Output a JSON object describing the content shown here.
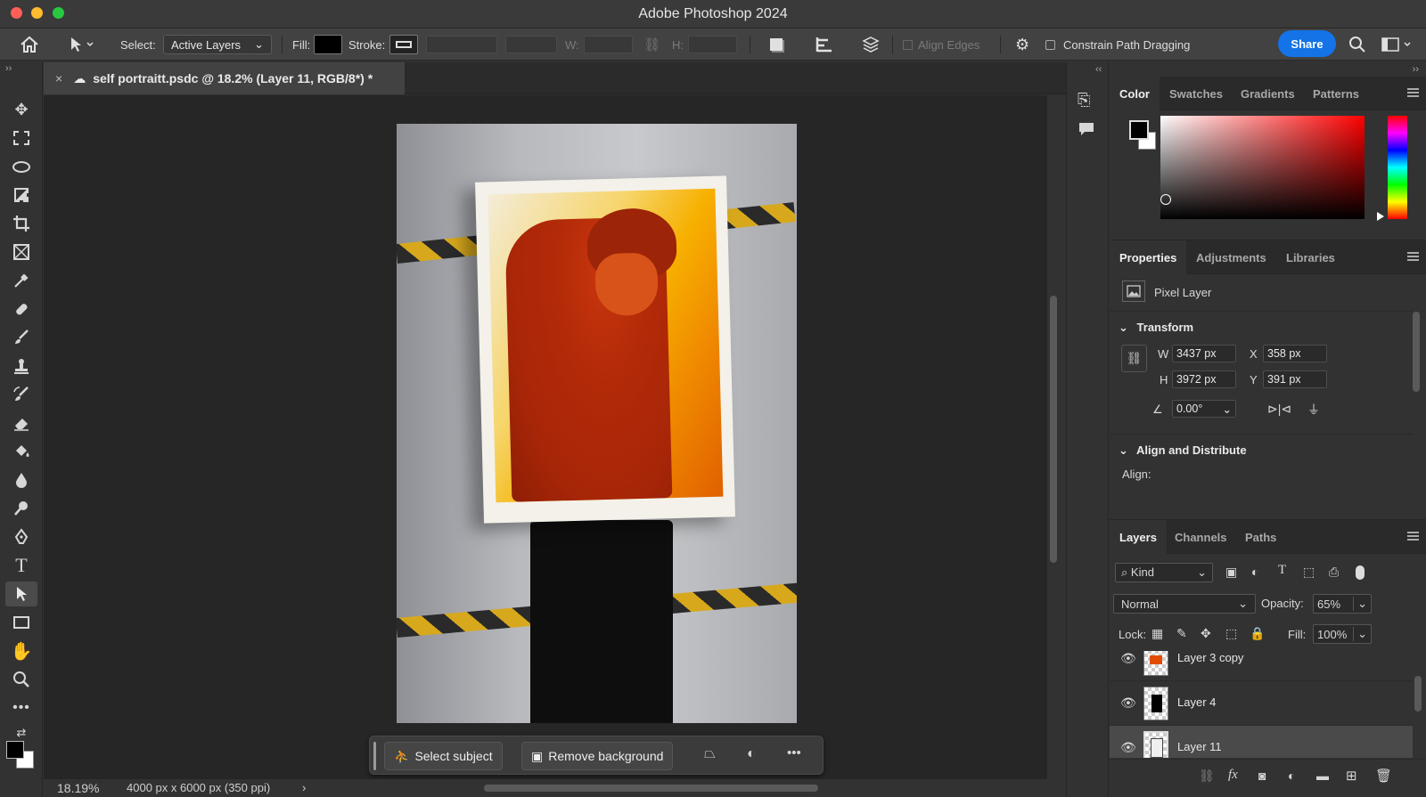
{
  "window": {
    "title": "Adobe Photoshop 2024"
  },
  "options_bar": {
    "select_label": "Select:",
    "select_value": "Active Layers",
    "fill_label": "Fill:",
    "stroke_label": "Stroke:",
    "w_label": "W:",
    "h_label": "H:",
    "align_edges_label": "Align Edges",
    "constrain_label": "Constrain Path Dragging",
    "share_label": "Share"
  },
  "document": {
    "tab_title": "self portraitt.psdc @ 18.2% (Layer 11, RGB/8*) *",
    "zoom": "18.19%",
    "doc_info": "4000 px x 6000 px (350 ppi)"
  },
  "context_bar": {
    "select_subject": "Select subject",
    "remove_background": "Remove background"
  },
  "color_panel": {
    "tabs": [
      "Color",
      "Swatches",
      "Gradients",
      "Patterns"
    ],
    "foreground": "#000000",
    "background": "#ffffff"
  },
  "properties_panel": {
    "tabs": [
      "Properties",
      "Adjustments",
      "Libraries"
    ],
    "layer_type": "Pixel Layer",
    "transform_title": "Transform",
    "w_label": "W",
    "h_label": "H",
    "x_label": "X",
    "y_label": "Y",
    "w_value": "3437 px",
    "h_value": "3972 px",
    "x_value": "358 px",
    "y_value": "391 px",
    "angle_value": "0.00°",
    "align_title": "Align and Distribute",
    "align_label": "Align:"
  },
  "layers_panel": {
    "tabs": [
      "Layers",
      "Channels",
      "Paths"
    ],
    "kind_label": "Kind",
    "blend_mode": "Normal",
    "opacity_label": "Opacity:",
    "opacity_value": "65%",
    "lock_label": "Lock:",
    "fill_label": "Fill:",
    "fill_value": "100%",
    "layers": [
      {
        "name": "Layer 3 copy",
        "selected": false
      },
      {
        "name": "Layer 4",
        "selected": false
      },
      {
        "name": "Layer 11",
        "selected": true
      }
    ]
  },
  "colors": {
    "accent": "#1473e6",
    "panel": "#323232",
    "canvas": "#262626"
  }
}
